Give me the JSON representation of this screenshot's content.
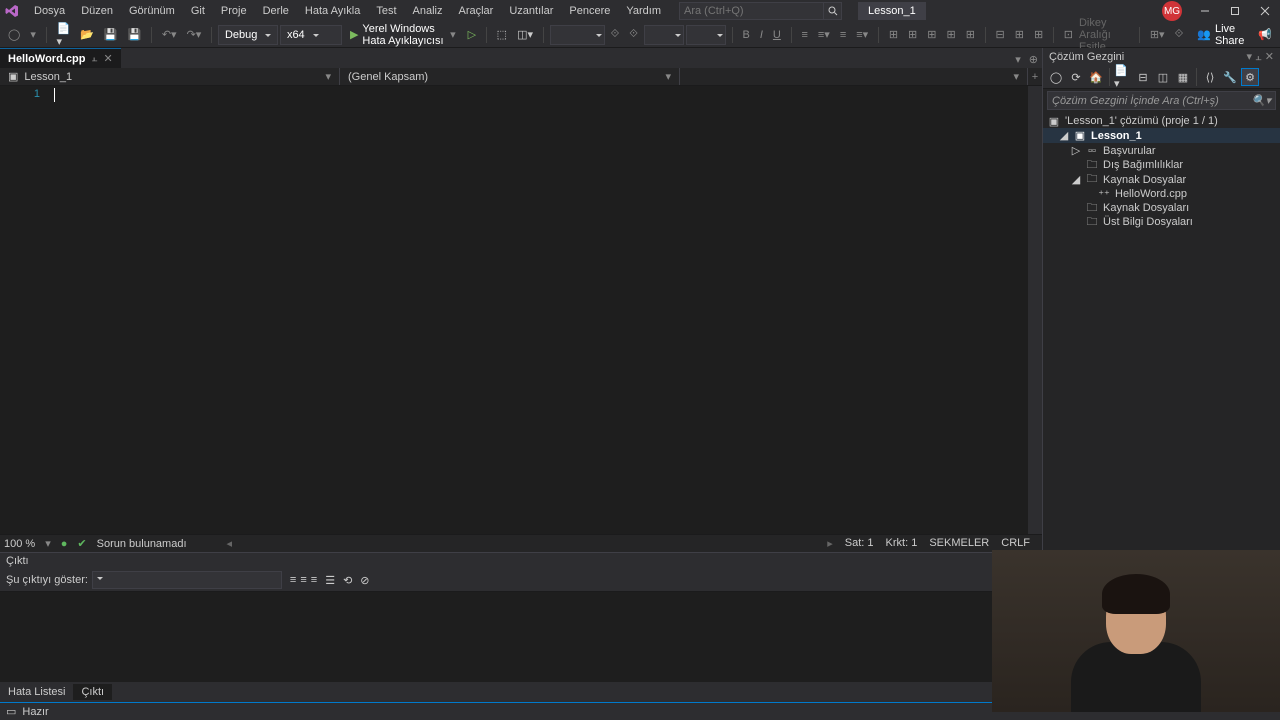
{
  "menu": [
    "Dosya",
    "Düzen",
    "Görünüm",
    "Git",
    "Proje",
    "Derle",
    "Hata Ayıkla",
    "Test",
    "Analiz",
    "Araçlar",
    "Uzantılar",
    "Pencere",
    "Yardım"
  ],
  "search_placeholder": "Ara (Ctrl+Q)",
  "project_name": "Lesson_1",
  "user_initials": "MG",
  "toolbar": {
    "config": "Debug",
    "platform": "x64",
    "debugger": "Yerel Windows Hata Ayıklayıcısı",
    "diff_label": "Dikey Aralığı Eşitle",
    "live_share": "Live Share"
  },
  "doc_tab": "HelloWord.cpp",
  "nav": {
    "scope1": "Lesson_1",
    "scope2": "(Genel Kapsam)"
  },
  "gutter_line": "1",
  "editor_status": {
    "zoom": "100 %",
    "issues": "Sorun bulunamadı",
    "line": "Sat: 1",
    "char": "Krkt: 1",
    "tabs": "SEKMELER",
    "ending": "CRLF"
  },
  "output": {
    "title": "Çıktı",
    "show_label": "Şu çıktıyı göster:"
  },
  "bottom_tabs": {
    "errors": "Hata Listesi",
    "output": "Çıktı"
  },
  "statusbar": {
    "ready": "Hazır"
  },
  "solution": {
    "title": "Çözüm Gezgini",
    "search": "Çözüm Gezgini İçinde Ara (Ctrl+ş)",
    "root": "'Lesson_1' çözümü (proje 1 / 1)",
    "project": "Lesson_1",
    "refs": "Başvurular",
    "external": "Dış Bağımlılıklar",
    "source": "Kaynak Dosyalar",
    "file": "HelloWord.cpp",
    "resource": "Kaynak Dosyaları",
    "headers": "Üst Bilgi Dosyaları"
  }
}
